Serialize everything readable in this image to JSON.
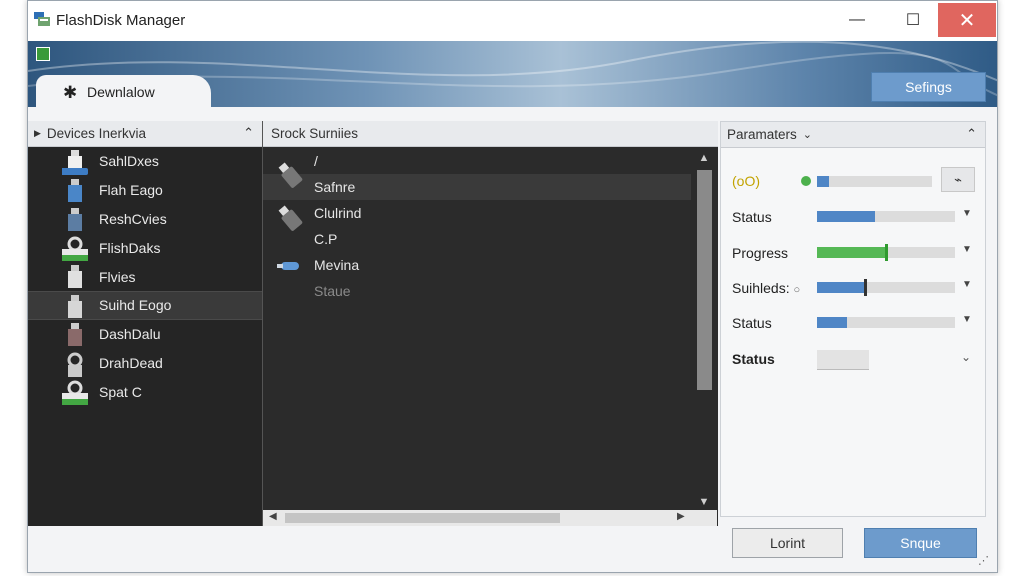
{
  "window": {
    "title": "FlashDisk Manager",
    "minimize": "—",
    "maximize": "☐",
    "close": "✕"
  },
  "toolbar": {
    "tab_label": "Dewnlalow",
    "settings_label": "Sefings"
  },
  "devices_panel": {
    "header": "Devices Inerkvia",
    "items": [
      {
        "label": "SahlDxes",
        "icon": "usb-drive-icon"
      },
      {
        "label": "Flah Eago",
        "icon": "usb-drive-icon"
      },
      {
        "label": "ReshCvies",
        "icon": "usb-drive-icon"
      },
      {
        "label": "FlishDaks",
        "icon": "usb-lock-icon"
      },
      {
        "label": "Flvies",
        "icon": "usb-drive-icon"
      },
      {
        "label": "Suihd Eogo",
        "icon": "usb-drive-icon",
        "selected": true
      },
      {
        "label": "DashDalu",
        "icon": "usb-drive-icon"
      },
      {
        "label": "DrahDead",
        "icon": "usb-lock-icon"
      },
      {
        "label": "Spat C",
        "icon": "usb-lock-icon"
      }
    ]
  },
  "files_panel": {
    "header": "Srock Surniies",
    "items": [
      {
        "label": "/"
      },
      {
        "label": "Safnre"
      },
      {
        "label": "Clulrind"
      },
      {
        "label": "C.P"
      },
      {
        "label": "Mevina"
      },
      {
        "label": "Staue"
      }
    ]
  },
  "params_panel": {
    "header": "Paramaters",
    "rows": [
      {
        "label": "(oO)",
        "value": 0.1,
        "color": "#4f86c6"
      },
      {
        "label": "Status",
        "value": 0.42,
        "color": "#4f86c6"
      },
      {
        "label": "Progress",
        "value": 0.5,
        "color": "#55b855"
      },
      {
        "label": "Suihleds:",
        "value": 0.35,
        "color": "#4f86c6"
      },
      {
        "label": "Status",
        "value": 0.22,
        "color": "#4f86c6"
      },
      {
        "label": "Status"
      }
    ]
  },
  "footer": {
    "cancel_label": "Lorint",
    "apply_label": "Snque"
  },
  "colors": {
    "accent": "#6d9bcc",
    "close_red": "#e0665f",
    "progress_green": "#55b855",
    "slider_blue": "#4f86c6"
  }
}
